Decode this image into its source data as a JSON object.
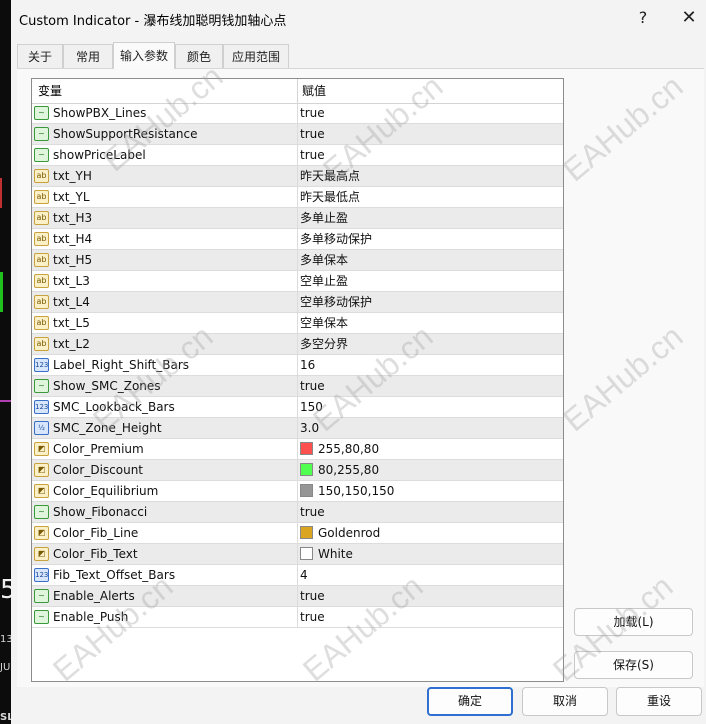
{
  "window": {
    "title": "Custom Indicator - 瀑布线加聪明钱加轴心点",
    "help_glyph": "?",
    "close_glyph": "✕"
  },
  "tabs": [
    {
      "label": "关于"
    },
    {
      "label": "常用"
    },
    {
      "label": "输入参数",
      "active": true
    },
    {
      "label": "颜色"
    },
    {
      "label": "应用范围"
    }
  ],
  "grid": {
    "header_name": "变量",
    "header_value": "赋值",
    "rows": [
      {
        "name": "ShowPBX_Lines",
        "value": "true",
        "type": "bool",
        "icon_text": "~"
      },
      {
        "name": "ShowSupportResistance",
        "value": "true",
        "type": "bool",
        "icon_text": "~"
      },
      {
        "name": "showPriceLabel",
        "value": "true",
        "type": "bool",
        "icon_text": "~"
      },
      {
        "name": "txt_YH",
        "value": "昨天最高点",
        "type": "str",
        "icon_text": "ab"
      },
      {
        "name": "txt_YL",
        "value": "昨天最低点",
        "type": "str",
        "icon_text": "ab"
      },
      {
        "name": "txt_H3",
        "value": "多单止盈",
        "type": "str",
        "icon_text": "ab"
      },
      {
        "name": "txt_H4",
        "value": "多单移动保护",
        "type": "str",
        "icon_text": "ab"
      },
      {
        "name": "txt_H5",
        "value": "多单保本",
        "type": "str",
        "icon_text": "ab"
      },
      {
        "name": "txt_L3",
        "value": "空单止盈",
        "type": "str",
        "icon_text": "ab"
      },
      {
        "name": "txt_L4",
        "value": "空单移动保护",
        "type": "str",
        "icon_text": "ab"
      },
      {
        "name": "txt_L5",
        "value": "空单保本",
        "type": "str",
        "icon_text": "ab"
      },
      {
        "name": "txt_L2",
        "value": "多空分界",
        "type": "str",
        "icon_text": "ab"
      },
      {
        "name": "Label_Right_Shift_Bars",
        "value": "16",
        "type": "int",
        "icon_text": "123"
      },
      {
        "name": "Show_SMC_Zones",
        "value": "true",
        "type": "bool",
        "icon_text": "~"
      },
      {
        "name": "SMC_Lookback_Bars",
        "value": "150",
        "type": "int",
        "icon_text": "123"
      },
      {
        "name": "SMC_Zone_Height",
        "value": "3.0",
        "type": "dbl",
        "icon_text": "½"
      },
      {
        "name": "Color_Premium",
        "value": "255,80,80",
        "type": "col",
        "icon_text": "◩",
        "swatch": "#ff5050"
      },
      {
        "name": "Color_Discount",
        "value": "80,255,80",
        "type": "col",
        "icon_text": "◩",
        "swatch": "#50ff50"
      },
      {
        "name": "Color_Equilibrium",
        "value": "150,150,150",
        "type": "col",
        "icon_text": "◩",
        "swatch": "#969696"
      },
      {
        "name": "Show_Fibonacci",
        "value": "true",
        "type": "bool",
        "icon_text": "~"
      },
      {
        "name": "Color_Fib_Line",
        "value": "Goldenrod",
        "type": "col",
        "icon_text": "◩",
        "swatch": "#daa520"
      },
      {
        "name": "Color_Fib_Text",
        "value": "White",
        "type": "col",
        "icon_text": "◩",
        "swatch": "#ffffff"
      },
      {
        "name": "Fib_Text_Offset_Bars",
        "value": "4",
        "type": "int",
        "icon_text": "123"
      },
      {
        "name": "Enable_Alerts",
        "value": "true",
        "type": "bool",
        "icon_text": "~"
      },
      {
        "name": "Enable_Push",
        "value": "true",
        "type": "bool",
        "icon_text": "~"
      }
    ]
  },
  "buttons": {
    "load": "加载(L)",
    "save": "保存(S)",
    "ok": "确定",
    "cancel": "取消",
    "reset": "重设"
  },
  "watermark_text": "EAHub.cn",
  "chart_strip": {
    "label_1": "5",
    "label_2": "13",
    "label_3": "JU",
    "label_4": "SL"
  }
}
